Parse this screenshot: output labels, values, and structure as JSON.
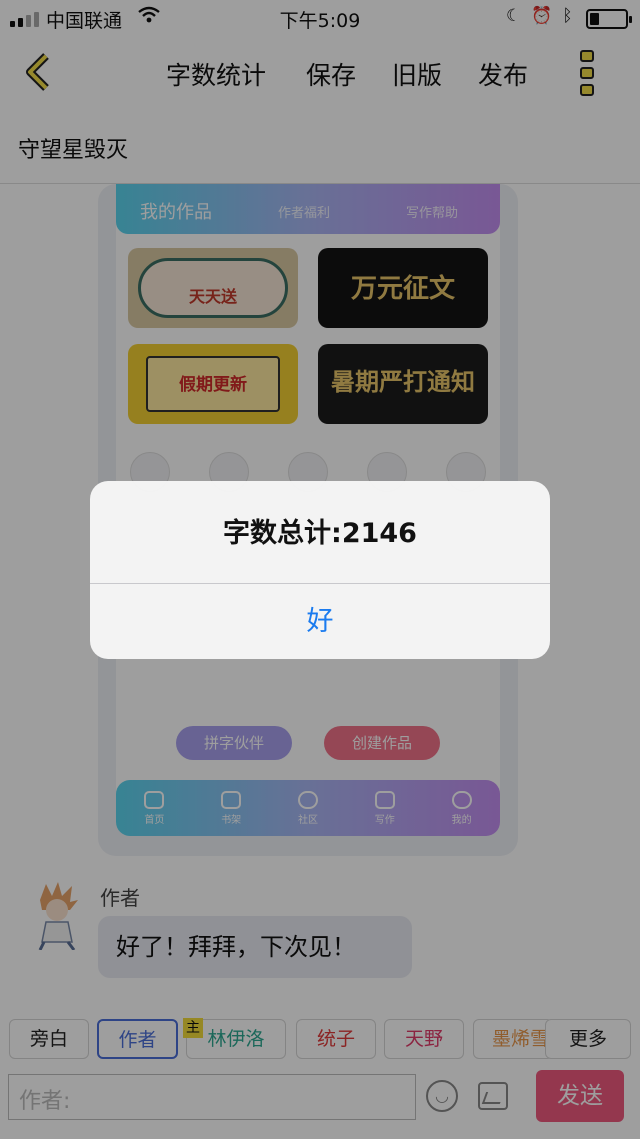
{
  "status_bar": {
    "carrier": "中国联通",
    "time": "下午5:09"
  },
  "nav": {
    "word_count": "字数统计",
    "save": "保存",
    "old_version": "旧版",
    "publish": "发布"
  },
  "story": {
    "title": "守望星毁灭"
  },
  "embedded_screenshot": {
    "tabs": [
      "我的作品",
      "作者福利",
      "写作帮助"
    ],
    "banners": [
      "天天送",
      "万元征文",
      "假期更新",
      "暑期严打通知"
    ],
    "buttons": [
      "拼字伙伴",
      "创建作品"
    ],
    "bottom_nav": [
      "首页",
      "书架",
      "社区",
      "写作",
      "我的"
    ]
  },
  "message": {
    "author": "作者",
    "text": "好了！拜拜，下次见！"
  },
  "roles": {
    "items": [
      "旁白",
      "作者",
      "林伊洛",
      "统子",
      "天野",
      "墨烯雪"
    ],
    "badge": "主",
    "more": "更多",
    "colors": {
      "author": "#4b6fd8",
      "lin": "#2ea891",
      "tongzi": "#e03a3a",
      "tianye": "#e03a6a",
      "moxi": "#e8964a"
    }
  },
  "input": {
    "placeholder": "作者:",
    "send": "发送"
  },
  "alert": {
    "message": "字数总计:2146",
    "ok": "好"
  },
  "colors": {
    "send_button": "#ef5a7e",
    "alert_button": "#1a7bef",
    "accent": "#f3dd4a"
  }
}
